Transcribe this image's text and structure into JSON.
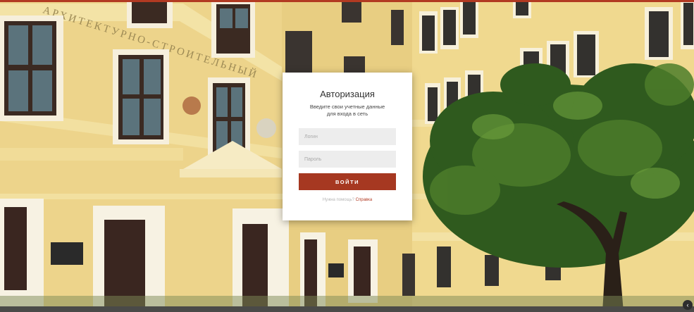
{
  "login": {
    "title": "Авторизация",
    "subtitle_line1": "Введите свои учетные данные",
    "subtitle_line2": "для входа в сеть",
    "login_placeholder": "Логин",
    "password_placeholder": "Пароль",
    "submit_label": "ВОЙТИ",
    "help_prompt": "Нужна помощь?",
    "help_link": "Справка"
  },
  "background": {
    "facade_inscription": "АРХИТЕКТУРНО-СТРОИТЕЛЬНЫЙ"
  },
  "colors": {
    "accent": "#a63821",
    "facade": "#ecd38b",
    "trim": "#f7f1e0",
    "foliage": "#2f5a1e"
  },
  "icons": {
    "corner": "chevron-icon"
  }
}
